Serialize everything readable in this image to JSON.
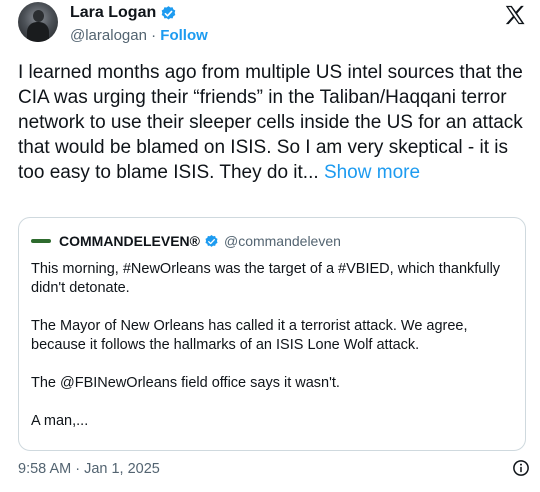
{
  "author": {
    "name": "Lara Logan",
    "handle": "@laralogan",
    "separator": "·",
    "follow_label": "Follow"
  },
  "icons": {
    "verified": "verified-badge-icon",
    "brand": "x-logo-icon",
    "info": "info-icon"
  },
  "colors": {
    "accent": "#1d9bf0",
    "text": "#0f1419",
    "muted": "#536471",
    "border": "#cfd9de"
  },
  "tweet": {
    "text": "I learned months ago from multiple US intel sources that the CIA was urging their “friends” in the Taliban/Haqqani terror network to use their sleeper cells inside the US for an attack that would be blamed on ISIS. So I am very skeptical - it is too easy to blame ISIS. They do it...",
    "show_more": "Show more"
  },
  "quote": {
    "name": "COMMANDELEVEN®",
    "handle": "@commandeleven",
    "paragraphs": [
      "This morning, #NewOrleans was the target of a #VBIED, which thankfully didn't detonate.",
      "The Mayor of New Orleans has called it a terrorist attack. We agree, because it follows the hallmarks of an ISIS Lone Wolf attack.",
      "The @FBINewOrleans field office says it wasn't.",
      "A man,..."
    ]
  },
  "timestamp": "9:58 AM · Jan 1, 2025"
}
